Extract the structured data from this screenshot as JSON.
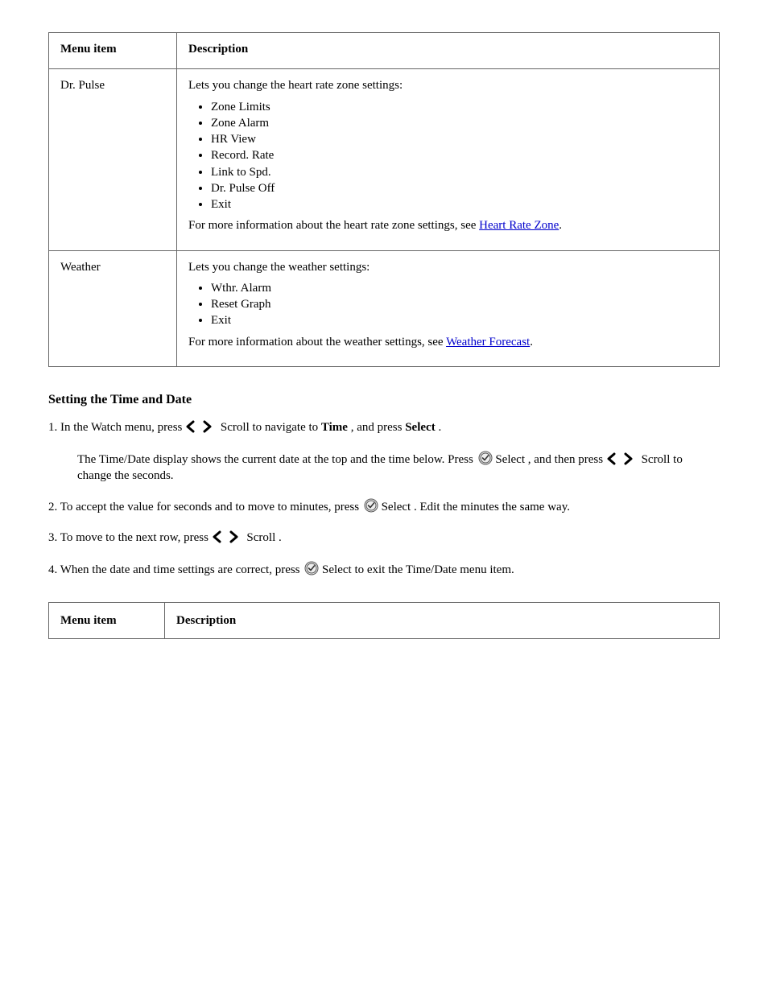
{
  "table1": {
    "headers": [
      "Menu item",
      "Description"
    ],
    "rows": [
      {
        "left": "Dr. Pulse",
        "intro": "Lets you change the heart rate zone settings:",
        "items": [
          "Zone Limits",
          "Zone Alarm",
          "HR View",
          "Record. Rate",
          "Link to Spd.",
          "Dr. Pulse Off",
          "Exit"
        ],
        "outro_pre": "For more information about the heart rate zone settings, see ",
        "outro_link": "Heart Rate Zone",
        "outro_post": "."
      },
      {
        "left": "Weather",
        "intro": "Lets you change the weather settings:",
        "items": [
          "Wthr. Alarm",
          "Reset Graph",
          "Exit"
        ],
        "outro_pre": "For more information about the weather settings, see ",
        "outro_link": "Weather Forecast",
        "outro_post": "."
      }
    ]
  },
  "section_title": "Setting the Time and Date",
  "steps": {
    "s1": {
      "pre": "1. In the Watch menu, press ",
      "scroll_label": "Scroll",
      "mid": " to navigate to ",
      "boldA": "Time",
      "mid2": ", and press ",
      "boldB": "Select",
      "post": "."
    },
    "s2": {
      "pre": "The Time/Date display shows the current date at the top and the time below. Press ",
      "check_label": "Select",
      "post": ", and then press ",
      "scroll_label": "Scroll",
      "post2": " to change the seconds."
    },
    "s3": {
      "pre": "2. To accept the value for seconds and to move to minutes, press ",
      "check_label": "Select",
      "post": ". Edit the minutes the same way."
    },
    "s4": {
      "pre": "3. To move to the next row, press ",
      "scroll_label": "Scroll",
      "post": "."
    },
    "s5": {
      "pre": "4. When the date and time settings are correct, press ",
      "check_label": "Select",
      "post": " to exit the Time/Date menu item."
    }
  },
  "table2": {
    "headers": [
      "Menu item",
      "Description"
    ]
  }
}
